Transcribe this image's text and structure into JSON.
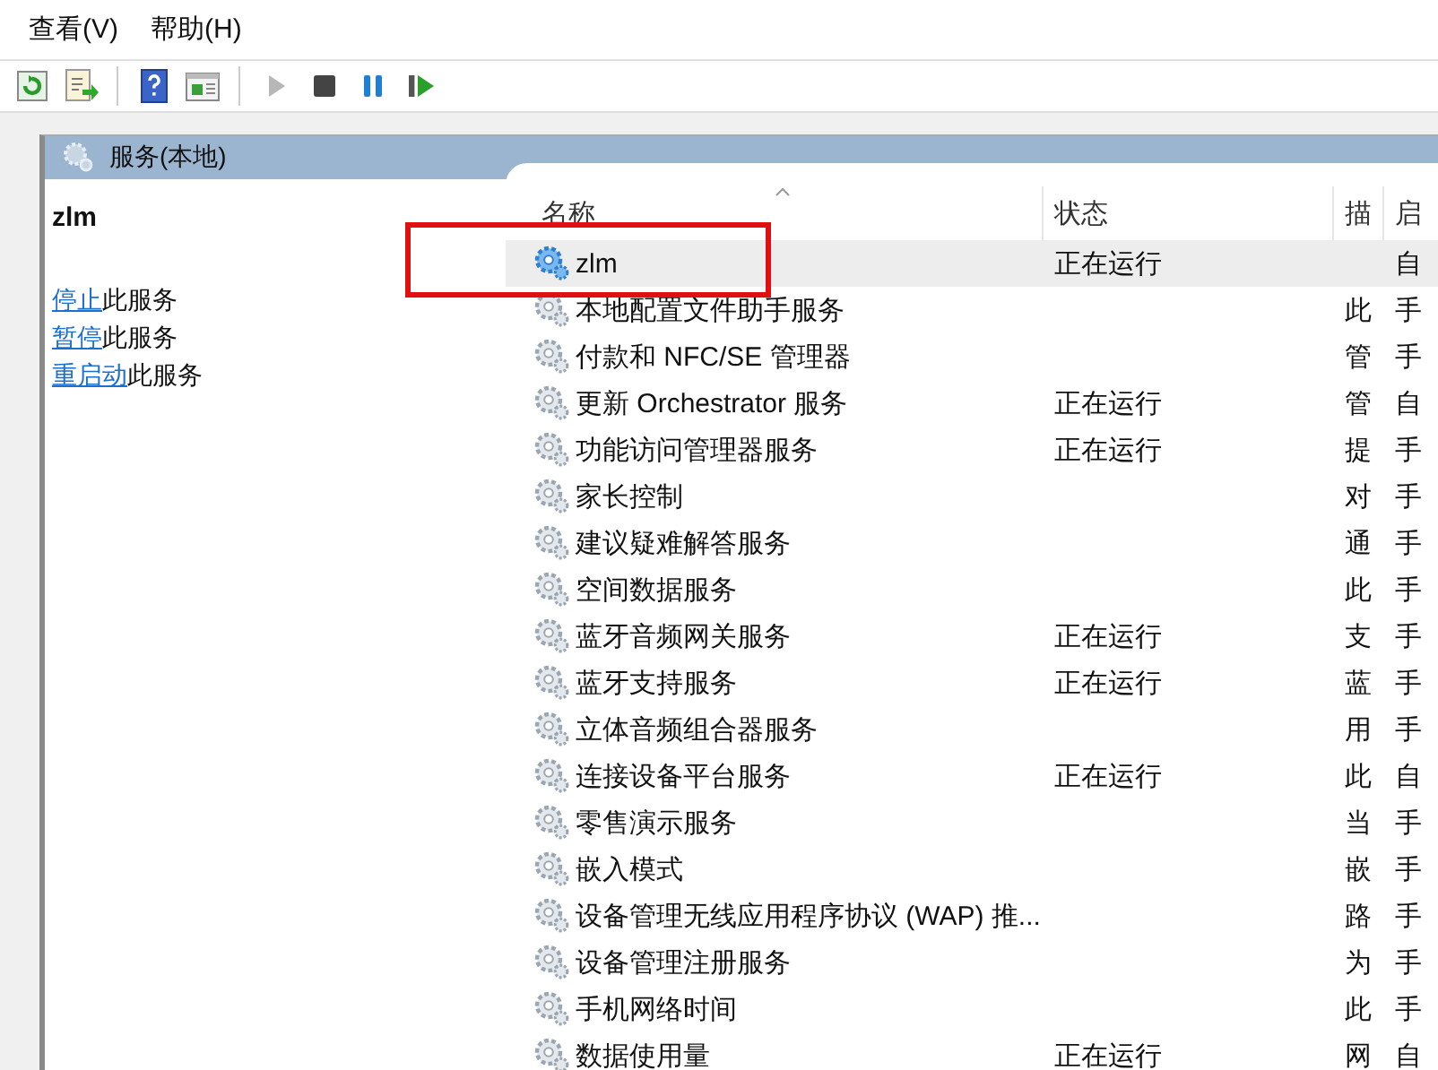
{
  "menu": [
    {
      "label": "查看(V)"
    },
    {
      "label": "帮助(H)"
    }
  ],
  "toolbar": [
    {
      "kind": "refresh",
      "disabled": false
    },
    {
      "kind": "export",
      "disabled": false
    },
    {
      "kind": "separator"
    },
    {
      "kind": "help",
      "disabled": false
    },
    {
      "kind": "view",
      "disabled": false
    },
    {
      "kind": "separator"
    },
    {
      "kind": "start",
      "disabled": true
    },
    {
      "kind": "stop",
      "disabled": false
    },
    {
      "kind": "pause",
      "disabled": false
    },
    {
      "kind": "resume",
      "disabled": false
    }
  ],
  "panel_title": "服务(本地)",
  "details": {
    "title": "zlm",
    "actions": [
      {
        "link": "停止",
        "text": "此服务"
      },
      {
        "link": "暂停",
        "text": "此服务"
      },
      {
        "link": "重启动",
        "text": "此服务"
      }
    ]
  },
  "table": {
    "columns": [
      {
        "label": "名称",
        "sorted": true
      },
      {
        "label": "状态"
      },
      {
        "label": "描"
      },
      {
        "label": "启"
      }
    ],
    "rows": [
      {
        "name": "zlm",
        "status": "正在运行",
        "column_3": "",
        "column_4": "自",
        "selected": true
      },
      {
        "name": "本地配置文件助手服务",
        "status": "",
        "column_3": "此",
        "column_4": "手",
        "selected": false
      },
      {
        "name": "付款和 NFC/SE 管理器",
        "status": "",
        "column_3": "管",
        "column_4": "手",
        "selected": false
      },
      {
        "name": "更新 Orchestrator 服务",
        "status": "正在运行",
        "column_3": "管",
        "column_4": "自",
        "selected": false
      },
      {
        "name": "功能访问管理器服务",
        "status": "正在运行",
        "column_3": "提",
        "column_4": "手",
        "selected": false
      },
      {
        "name": "家长控制",
        "status": "",
        "column_3": "对",
        "column_4": "手",
        "selected": false
      },
      {
        "name": "建议疑难解答服务",
        "status": "",
        "column_3": "通",
        "column_4": "手",
        "selected": false
      },
      {
        "name": "空间数据服务",
        "status": "",
        "column_3": "此",
        "column_4": "手",
        "selected": false
      },
      {
        "name": "蓝牙音频网关服务",
        "status": "正在运行",
        "column_3": "支",
        "column_4": "手",
        "selected": false
      },
      {
        "name": "蓝牙支持服务",
        "status": "正在运行",
        "column_3": "蓝",
        "column_4": "手",
        "selected": false
      },
      {
        "name": "立体音频组合器服务",
        "status": "",
        "column_3": "用",
        "column_4": "手",
        "selected": false
      },
      {
        "name": "连接设备平台服务",
        "status": "正在运行",
        "column_3": "此",
        "column_4": "自",
        "selected": false
      },
      {
        "name": "零售演示服务",
        "status": "",
        "column_3": "当",
        "column_4": "手",
        "selected": false
      },
      {
        "name": "嵌入模式",
        "status": "",
        "column_3": "嵌",
        "column_4": "手",
        "selected": false
      },
      {
        "name": "设备管理无线应用程序协议 (WAP) 推...",
        "status": "",
        "column_3": "路",
        "column_4": "手",
        "selected": false
      },
      {
        "name": "设备管理注册服务",
        "status": "",
        "column_3": "为",
        "column_4": "手",
        "selected": false
      },
      {
        "name": "手机网络时间",
        "status": "",
        "column_3": "此",
        "column_4": "手",
        "selected": false
      },
      {
        "name": "数据使用量",
        "status": "正在运行",
        "column_3": "网",
        "column_4": "自",
        "selected": false
      }
    ]
  }
}
